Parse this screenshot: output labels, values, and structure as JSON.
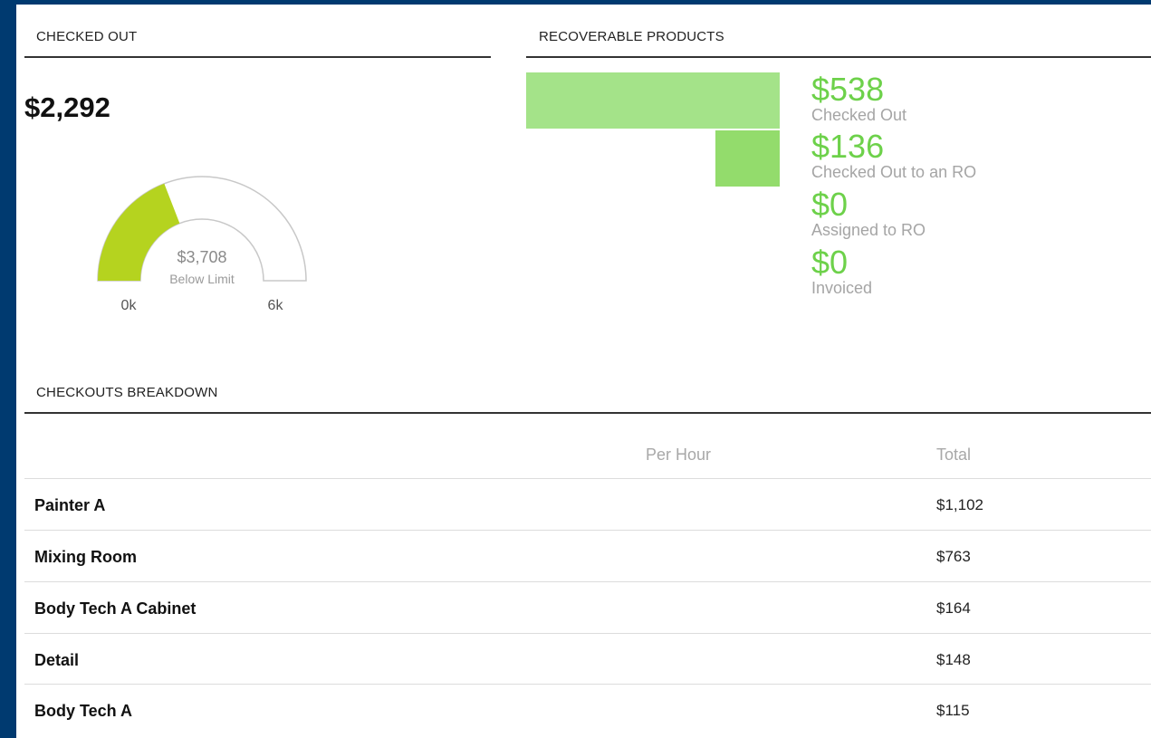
{
  "checked_out": {
    "title": "CHECKED OUT",
    "amount": "$2,292",
    "gauge": {
      "fraction": 0.382,
      "center_value": "$3,708",
      "center_caption": "Below Limit",
      "min_label": "0k",
      "max_label": "6k",
      "fill_color": "#b5d31f",
      "track_color": "#ffffff",
      "stroke_color": "#c8c8c8"
    }
  },
  "recoverable": {
    "title": "RECOVERABLE PRODUCTS",
    "max_value": 538,
    "items": [
      {
        "value_text": "$538",
        "value": 538,
        "caption": "Checked Out",
        "color": "#a4e389"
      },
      {
        "value_text": "$136",
        "value": 136,
        "caption": "Checked Out to an RO",
        "color": "#93dc6c"
      },
      {
        "value_text": "$0",
        "value": 0,
        "caption": "Assigned to RO",
        "color": "#85d55a"
      },
      {
        "value_text": "$0",
        "value": 0,
        "caption": "Invoiced",
        "color": "#79cf4b"
      }
    ]
  },
  "breakdown": {
    "title": "CHECKOUTS BREAKDOWN",
    "columns": {
      "per_hour": "Per Hour",
      "total": "Total"
    },
    "rows": [
      {
        "name": "Painter A",
        "per_hour": "",
        "total": "$1,102"
      },
      {
        "name": "Mixing Room",
        "per_hour": "",
        "total": "$763"
      },
      {
        "name": "Body Tech A Cabinet",
        "per_hour": "",
        "total": "$164"
      },
      {
        "name": "Detail",
        "per_hour": "",
        "total": "$148"
      },
      {
        "name": "Body Tech A",
        "per_hour": "",
        "total": "$115"
      }
    ]
  }
}
